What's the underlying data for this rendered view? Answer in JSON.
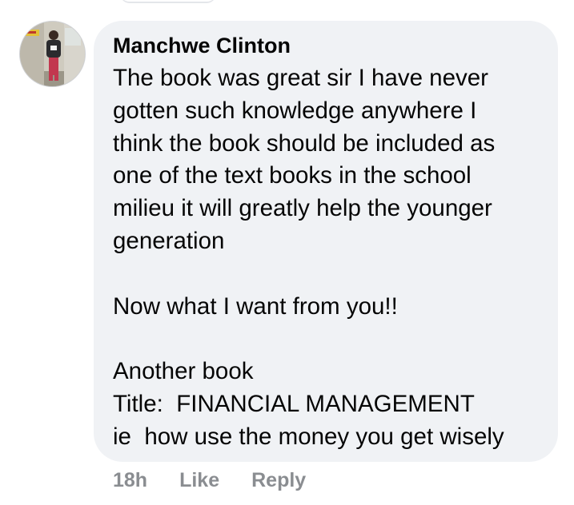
{
  "comment": {
    "author": "Manchwe Clinton",
    "avatar_icon": "user-profile-photo",
    "lines": [
      "The book was great sir I have never",
      "gotten such knowledge anywhere I",
      "think the book should be included as",
      "one of the text books in the school",
      "milieu it will greatly help the younger",
      "generation",
      "",
      "Now what I want from you!!",
      "",
      "Another book",
      "Title:  FINANCIAL MANAGEMENT",
      "ie  how use the money you get wisely"
    ],
    "timestamp": "18h",
    "like_label": "Like",
    "reply_label": "Reply"
  },
  "colors": {
    "bubble_background": "#f0f2f5",
    "text": "#050505",
    "meta_text": "#8a8d91"
  }
}
